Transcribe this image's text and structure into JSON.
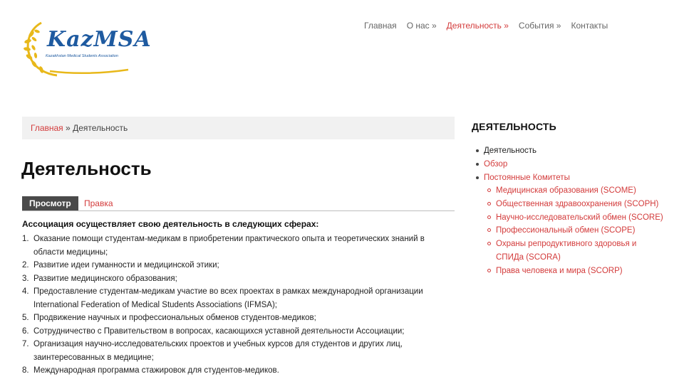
{
  "logo": {
    "text": "KazMSA",
    "subtitle": "Kazakhstan Medical Students Association"
  },
  "topnav": [
    {
      "label": "Главная"
    },
    {
      "label": "О нас »"
    },
    {
      "label": "Деятельность »"
    },
    {
      "label": "События »"
    },
    {
      "label": "Контакты"
    }
  ],
  "breadcrumb": {
    "home": "Главная",
    "separator": "»",
    "current": "Деятельность"
  },
  "page_title": "Деятельность",
  "tabs": {
    "view": "Просмотр",
    "edit": "Правка"
  },
  "content": {
    "intro": "Ассоциация осуществляет свою деятельность в следующих сферах:",
    "items": [
      {
        "num": "1.",
        "text": "Оказание помощи студентам-медикам в приобретении практического опыта и теоретических знаний в области медицины;"
      },
      {
        "num": "2.",
        "text": "Развитие идеи гуманности и медицинской этики;"
      },
      {
        "num": "3.",
        "text": "Развитие медицинского образования;"
      },
      {
        "num": "4.",
        "text": "Предоставление студентам-медикам участие во всех проектах в рамках международной организации International Federation of Medical Students Associations (IFMSA);"
      },
      {
        "num": "5.",
        "text": "Продвижение научных и профессиональных обменов студентов-медиков;"
      },
      {
        "num": "6.",
        "text": "Сотрудничество с Правительством в вопросах, касающихся уставной деятельности Ассоциации;"
      },
      {
        "num": "7.",
        "text": "Организация научно-исследовательских проектов и учебных курсов для студентов и других лиц, заинтересованных в медицине;"
      },
      {
        "num": "8.",
        "text": "Международная программа стажировок для студентов-медиков."
      }
    ]
  },
  "sidebar": {
    "title": "ДЕЯТЕЛЬНОСТЬ",
    "items": [
      {
        "label": "Деятельность"
      },
      {
        "label": "Обзор"
      },
      {
        "label": "Постоянные Комитеты"
      }
    ],
    "committees": [
      {
        "label": "Медицинская образования (SCOME)"
      },
      {
        "label": "Общественная здравоохранения (SCOPH)"
      },
      {
        "label": "Научно-исследовательский обмен (SCORE)"
      },
      {
        "label": "Профессиональный обмен (SCOPE)"
      },
      {
        "label": "Охраны репродуктивного здоровья и СПИДа (SCORA)"
      },
      {
        "label": "Права человека и мира (SCORP)"
      }
    ]
  },
  "colors": {
    "accent": "#d33b3b",
    "logo_blue": "#1e5aa0",
    "logo_gold": "#e8b81a",
    "breadcrumb_bg": "#f1f1f1",
    "tab_active_bg": "#4a4a4a"
  }
}
